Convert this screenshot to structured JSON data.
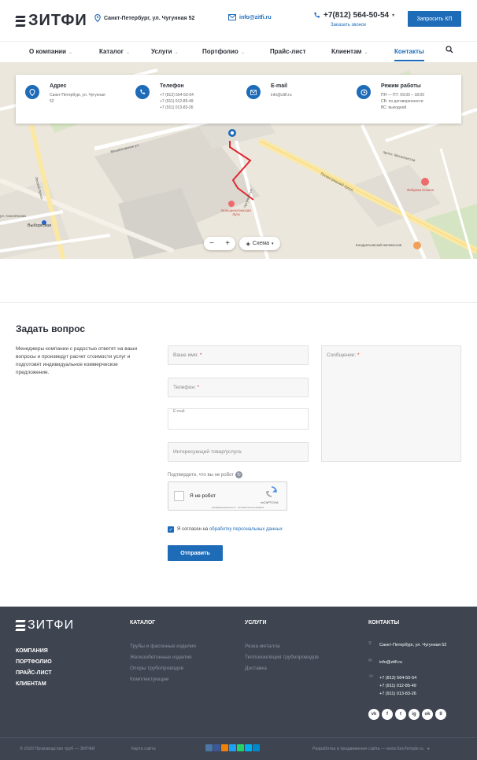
{
  "header": {
    "logo": "ЗИТФИ",
    "address": "Санкт-Петербург, ул. Чугунная 52",
    "email": "info@zitfi.ru",
    "phone": "+7(812) 564-50-54",
    "callback": "Заказать звонок",
    "cta_button": "Запросить КП"
  },
  "nav": {
    "items": [
      {
        "label": "О компании",
        "has_dropdown": true
      },
      {
        "label": "Каталог",
        "has_dropdown": true
      },
      {
        "label": "Услуги",
        "has_dropdown": true
      },
      {
        "label": "Портфолио",
        "has_dropdown": true
      },
      {
        "label": "Прайс-лист",
        "has_dropdown": false
      },
      {
        "label": "Клиентам",
        "has_dropdown": true
      },
      {
        "label": "Контакты",
        "has_dropdown": false,
        "active": true
      }
    ],
    "chevron": "⌄"
  },
  "contacts_bar": [
    {
      "title": "Адрес",
      "lines": "Санкт-Петербург, ул. Чугунная\n52",
      "icon": "pin-icon"
    },
    {
      "title": "Телефон",
      "lines": "+7 (812) 564-50-54\n+7 (911) 012-85-49\n+7 (911) 013-83-26",
      "icon": "phone-icon"
    },
    {
      "title": "E-mail",
      "lines": "info@zitfi.ru",
      "icon": "mail-icon"
    },
    {
      "title": "Режим работы",
      "lines": "ПН — ПТ: 09:00 – 18:00\nСБ: по договоренности\nВС: выходной",
      "icon": "clock-icon"
    }
  ],
  "map": {
    "zoom_minus": "−",
    "zoom_plus": "+",
    "scheme": "Схема",
    "labels": {
      "metro": "Выборгская",
      "hospital": "Большеохтинская Луги",
      "factory": "Фабрика Клевое",
      "residential": "Кондратьевский жилмассив",
      "street_1": "Полюстровский просп.",
      "street_2": "Чугунная ул.",
      "street_3": "Лесной просп.",
      "street_4": "просп. Металлистов",
      "street_5": "Михайловская ул.",
      "street_6": "ул. Смолячкова"
    }
  },
  "form": {
    "title": "Задать вопрос",
    "description": "Менеджеры компании с радостью ответят на ваши вопросы и произведут расчет стоимости услуг и подготовят индивидуальное коммерческое предложение.",
    "name_placeholder": "Ваше имя:",
    "phone_placeholder": "Телефон:",
    "email_label": "E-mail:",
    "product_placeholder": "Интересующий товар/услуга:",
    "message_placeholder": "Сообщение:",
    "required_mark": "*",
    "captcha_prompt": "Подтвердите, что вы не робот",
    "captcha_checkbox": "Я не робот",
    "captcha_brand": "reCAPTCHA",
    "captcha_terms": "Конфиденциальность · Условия использования",
    "agree_text": "Я согласен на",
    "agree_link": "обработку персональных данных",
    "submit": "Отправить"
  },
  "footer": {
    "logo": "ЗИТФИ",
    "main_links": [
      "КОМПАНИЯ",
      "ПОРТФОЛИО",
      "ПРАЙС-ЛИСТ",
      "КЛИЕНТАМ"
    ],
    "catalog_title": "КАТАЛОГ",
    "catalog_links": [
      "Трубы и фасонные изделия",
      "Железобетонные изделия",
      "Опоры трубопроводов",
      "Комплектующие"
    ],
    "services_title": "УСЛУГИ",
    "services_links": [
      "Резка металла",
      "Теплоизоляция трубопроводов",
      "Доставка"
    ],
    "contacts_title": "КОНТАКТЫ",
    "contact_address": "Санкт-Петербург, ул. Чугунная 52",
    "contact_email": "info@zitfi.ru",
    "contact_phones": "+7 (812) 564-50-54\n+7 (911) 012-85-49\n+7 (911) 013-83-26",
    "social": [
      "vk",
      "f",
      "t",
      "ig",
      "ok",
      "8"
    ],
    "copyright": "© 2020 Производство труб — ЗИТФИ",
    "sitemap": "Карта сайта",
    "developer": "Разработка и продвижение сайта — www.SeoTemple.ru"
  },
  "colors": {
    "accent": "#1e6bb8",
    "footer_bg": "#3e4450",
    "route": "#e0262f"
  }
}
